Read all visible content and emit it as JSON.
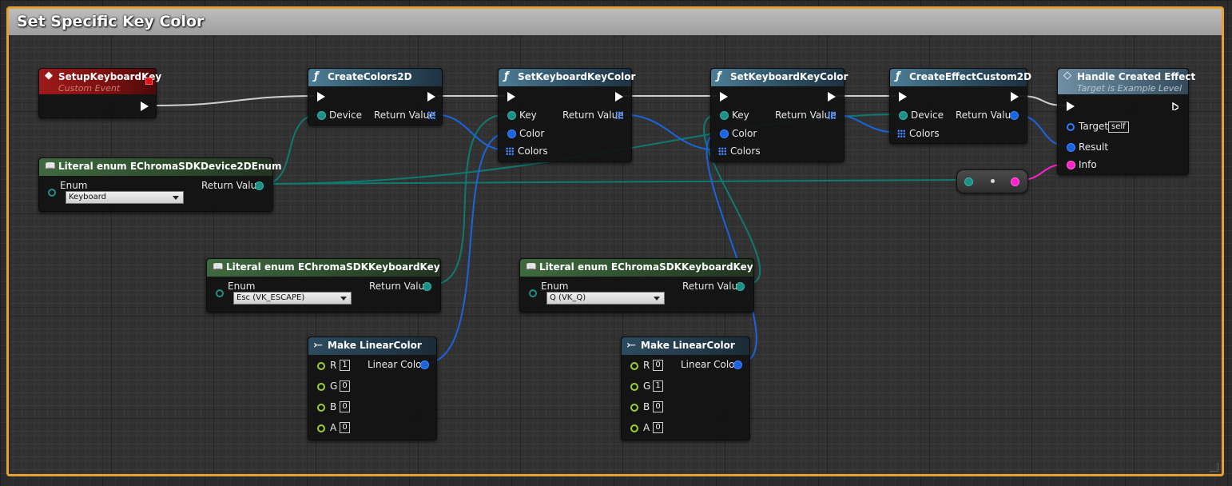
{
  "comment": {
    "title": "Set Specific Key Color"
  },
  "nodes": {
    "setup_event": {
      "title": "SetupKeyboardKey",
      "subtitle": "Custom Event"
    },
    "create_colors": {
      "title": "CreateColors2D",
      "pins": {
        "device": "Device",
        "return_value": "Return Value"
      }
    },
    "set_key_color_1": {
      "title": "SetKeyboardKeyColor",
      "pins": {
        "key": "Key",
        "color": "Color",
        "colors": "Colors",
        "return_value": "Return Value"
      }
    },
    "set_key_color_2": {
      "title": "SetKeyboardKeyColor",
      "pins": {
        "key": "Key",
        "color": "Color",
        "colors": "Colors",
        "return_value": "Return Value"
      }
    },
    "create_effect": {
      "title": "CreateEffectCustom2D",
      "pins": {
        "device": "Device",
        "colors": "Colors",
        "return_value": "Return Value"
      }
    },
    "handle_effect": {
      "title": "Handle Created Effect",
      "subtitle": "Target is Example Level",
      "pins": {
        "target": "Target",
        "target_value": "self",
        "result": "Result",
        "info": "Info"
      }
    },
    "literal_device": {
      "title": "Literal enum EChromaSDKDevice2DEnum",
      "pins": {
        "enum": "Enum",
        "return_value": "Return Value"
      },
      "value": "Keyboard"
    },
    "literal_key_1": {
      "title": "Literal enum EChromaSDKKeyboardKey",
      "pins": {
        "enum": "Enum",
        "return_value": "Return Value"
      },
      "value": "Esc (VK_ESCAPE)"
    },
    "literal_key_2": {
      "title": "Literal enum EChromaSDKKeyboardKey",
      "pins": {
        "enum": "Enum",
        "return_value": "Return Value"
      },
      "value": "Q (VK_Q)"
    },
    "make_color_1": {
      "title": "Make LinearColor",
      "pins": {
        "r": "R",
        "g": "G",
        "b": "B",
        "a": "A",
        "out": "Linear Color"
      },
      "values": {
        "r": "1",
        "g": "0",
        "b": "0",
        "a": "0"
      }
    },
    "make_color_2": {
      "title": "Make LinearColor",
      "pins": {
        "r": "R",
        "g": "G",
        "b": "B",
        "a": "A",
        "out": "Linear Color"
      },
      "values": {
        "r": "0",
        "g": "1",
        "b": "0",
        "a": "0"
      }
    }
  },
  "icons": {
    "function": "function-icon",
    "event": "event-diamond-icon",
    "literal": "book-icon",
    "make": "make-struct-icon"
  },
  "colors": {
    "comment_border": "#e4a233",
    "exec_wire": "#d8d8d8",
    "enum_wire": "#0f7a70",
    "struct_wire": "#1a64e0",
    "string_wire": "#ff22cc",
    "event_subtitle": "#d17a72",
    "handle_subtitle": "#b8c6d0"
  }
}
